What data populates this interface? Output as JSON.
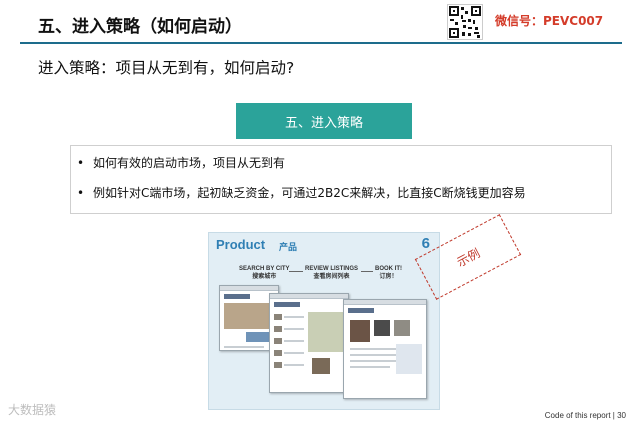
{
  "header": {
    "title": "五、进入策略（如何启动）",
    "wechat": "微信号：PEVC007"
  },
  "subtitle": "进入策略：项目从无到有，如何启动?",
  "section_banner": "五、进入策略",
  "bullets": [
    "如何有效的启动市场，项目从无到有",
    "例如针对C端市场，起初缺乏资金，可通过2B2C来解决，比直接C断烧钱更加容易"
  ],
  "bullet_symbol": "•",
  "product_panel": {
    "title": "Product",
    "title_cn": "产品",
    "number": "6",
    "steps": [
      {
        "en": "SEARCH BY CITY",
        "cn": "搜索城市"
      },
      {
        "en": "REVIEW LISTINGS",
        "cn": "查看房间列表"
      },
      {
        "en": "BOOK IT!",
        "cn": "订房！"
      }
    ]
  },
  "sample_stamp": "示例",
  "watermark": "大数据猿",
  "footer": "Code of this report  | 30",
  "colors": {
    "header_rule": "#1d6c8c",
    "banner": "#2ba39a",
    "wechat": "#d43c2a",
    "product_blue": "#2f7fb4",
    "stamp": "#c0392b"
  },
  "icons": [
    "qr-code-icon"
  ]
}
